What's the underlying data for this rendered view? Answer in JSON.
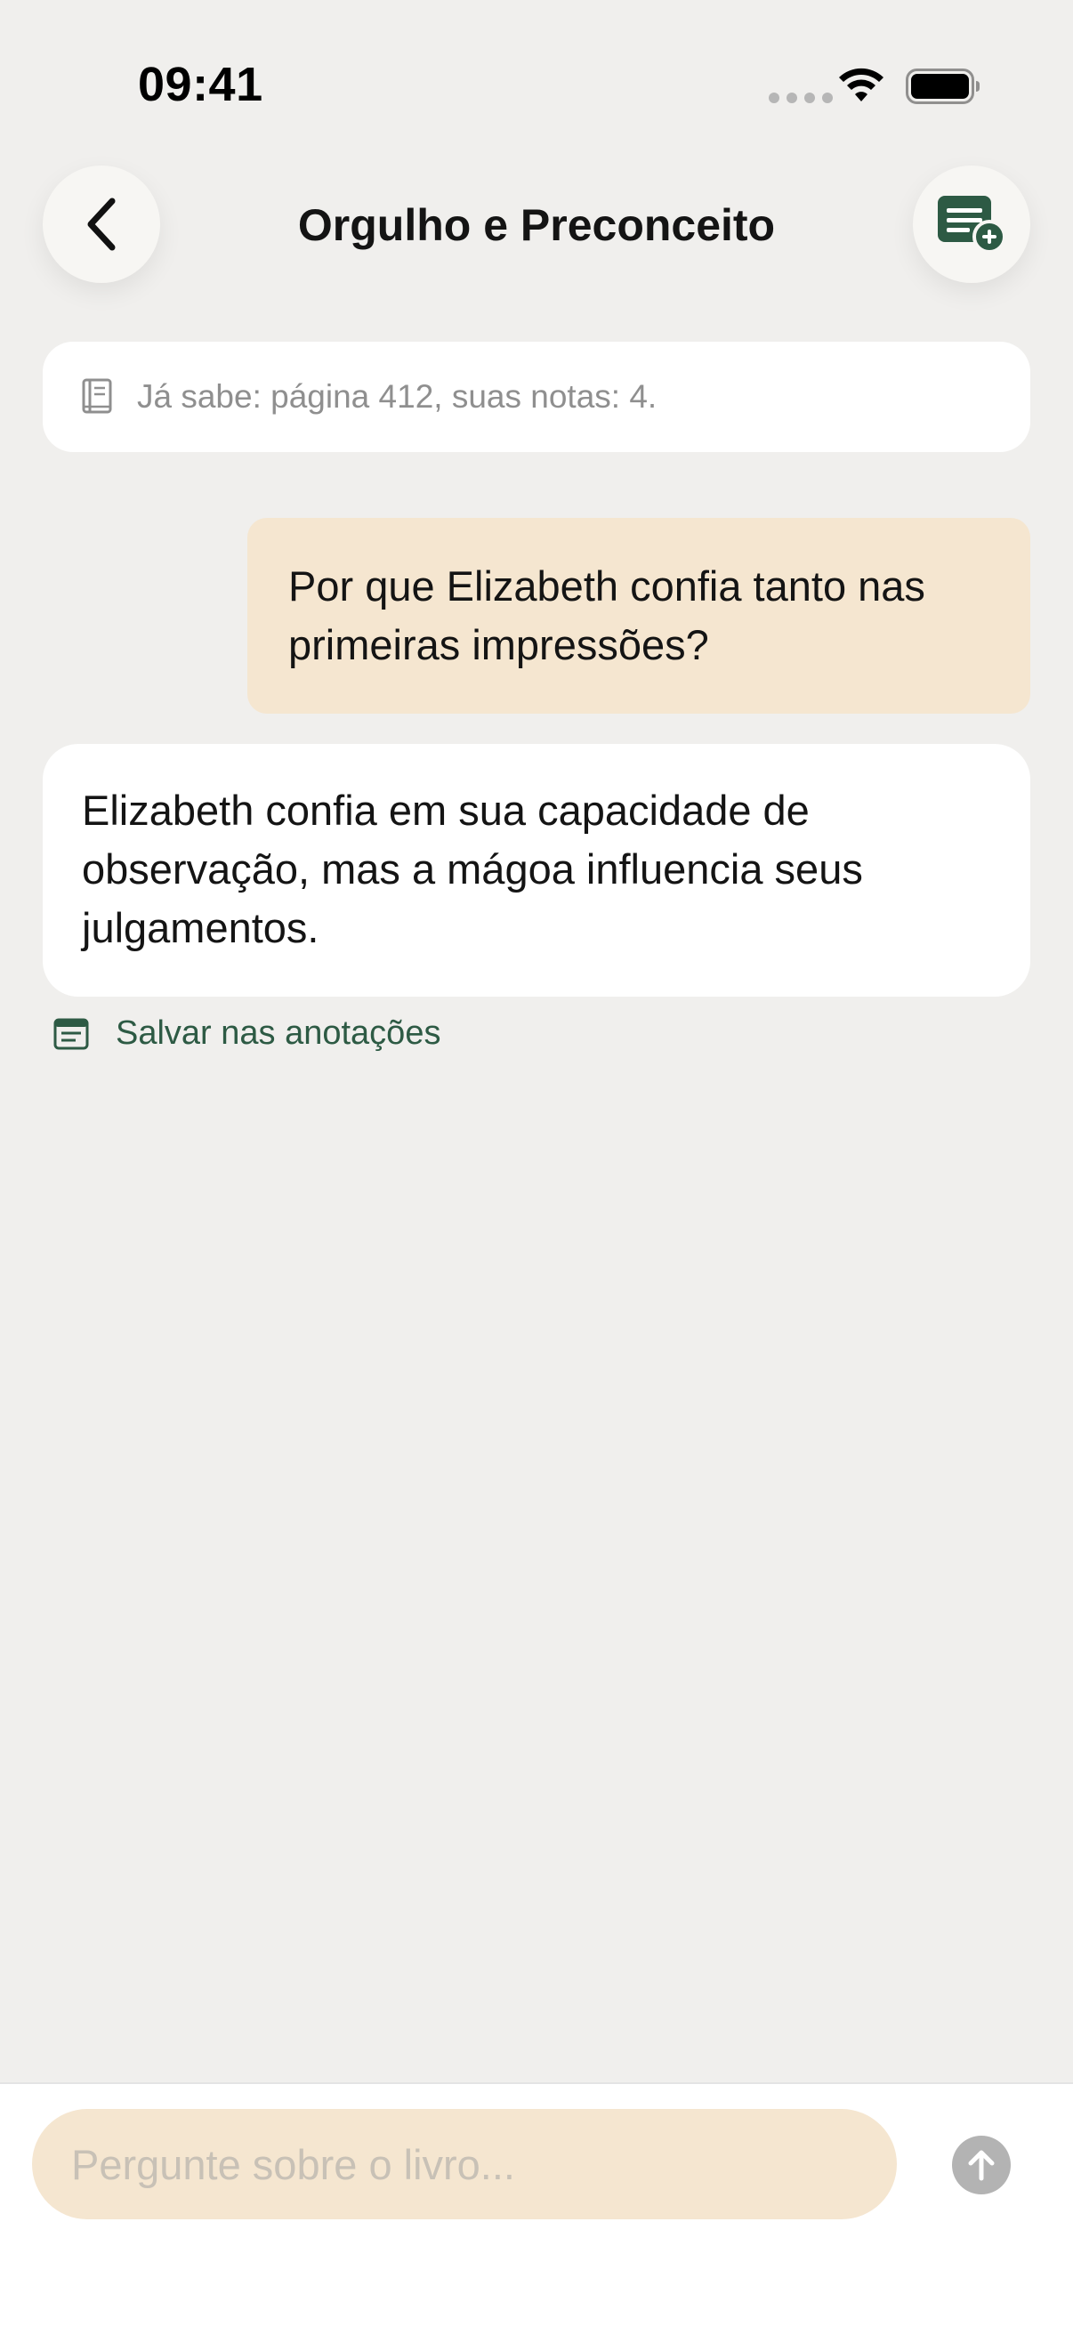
{
  "status_bar": {
    "time": "09:41",
    "icons": [
      "cellular-dots-icon",
      "wifi-icon",
      "battery-icon"
    ]
  },
  "header": {
    "title": "Orgulho e Preconceito",
    "back_icon": "chevron-left-icon",
    "notes_icon": "notes-add-icon"
  },
  "context": {
    "icon": "book-icon",
    "text": "Já sabe: página 412, suas notas: 4."
  },
  "messages": [
    {
      "role": "user",
      "text": "Por que Elizabeth confia tanto nas primeiras impressões?"
    },
    {
      "role": "assistant",
      "text": "Elizabeth confia em sua capacidade de observação, mas a mágoa influencia seus julgamentos."
    }
  ],
  "save_notes": {
    "icon": "note-icon",
    "label": "Salvar nas anotações"
  },
  "composer": {
    "placeholder": "Pergunte sobre o livro...",
    "value": "",
    "send_icon": "arrow-up-icon"
  },
  "colors": {
    "background": "#f0efed",
    "accent_green": "#2d5a44",
    "user_bubble": "#f5e6d0",
    "input_fill": "#f5e6d0",
    "send_disabled": "#b3b3b3"
  }
}
